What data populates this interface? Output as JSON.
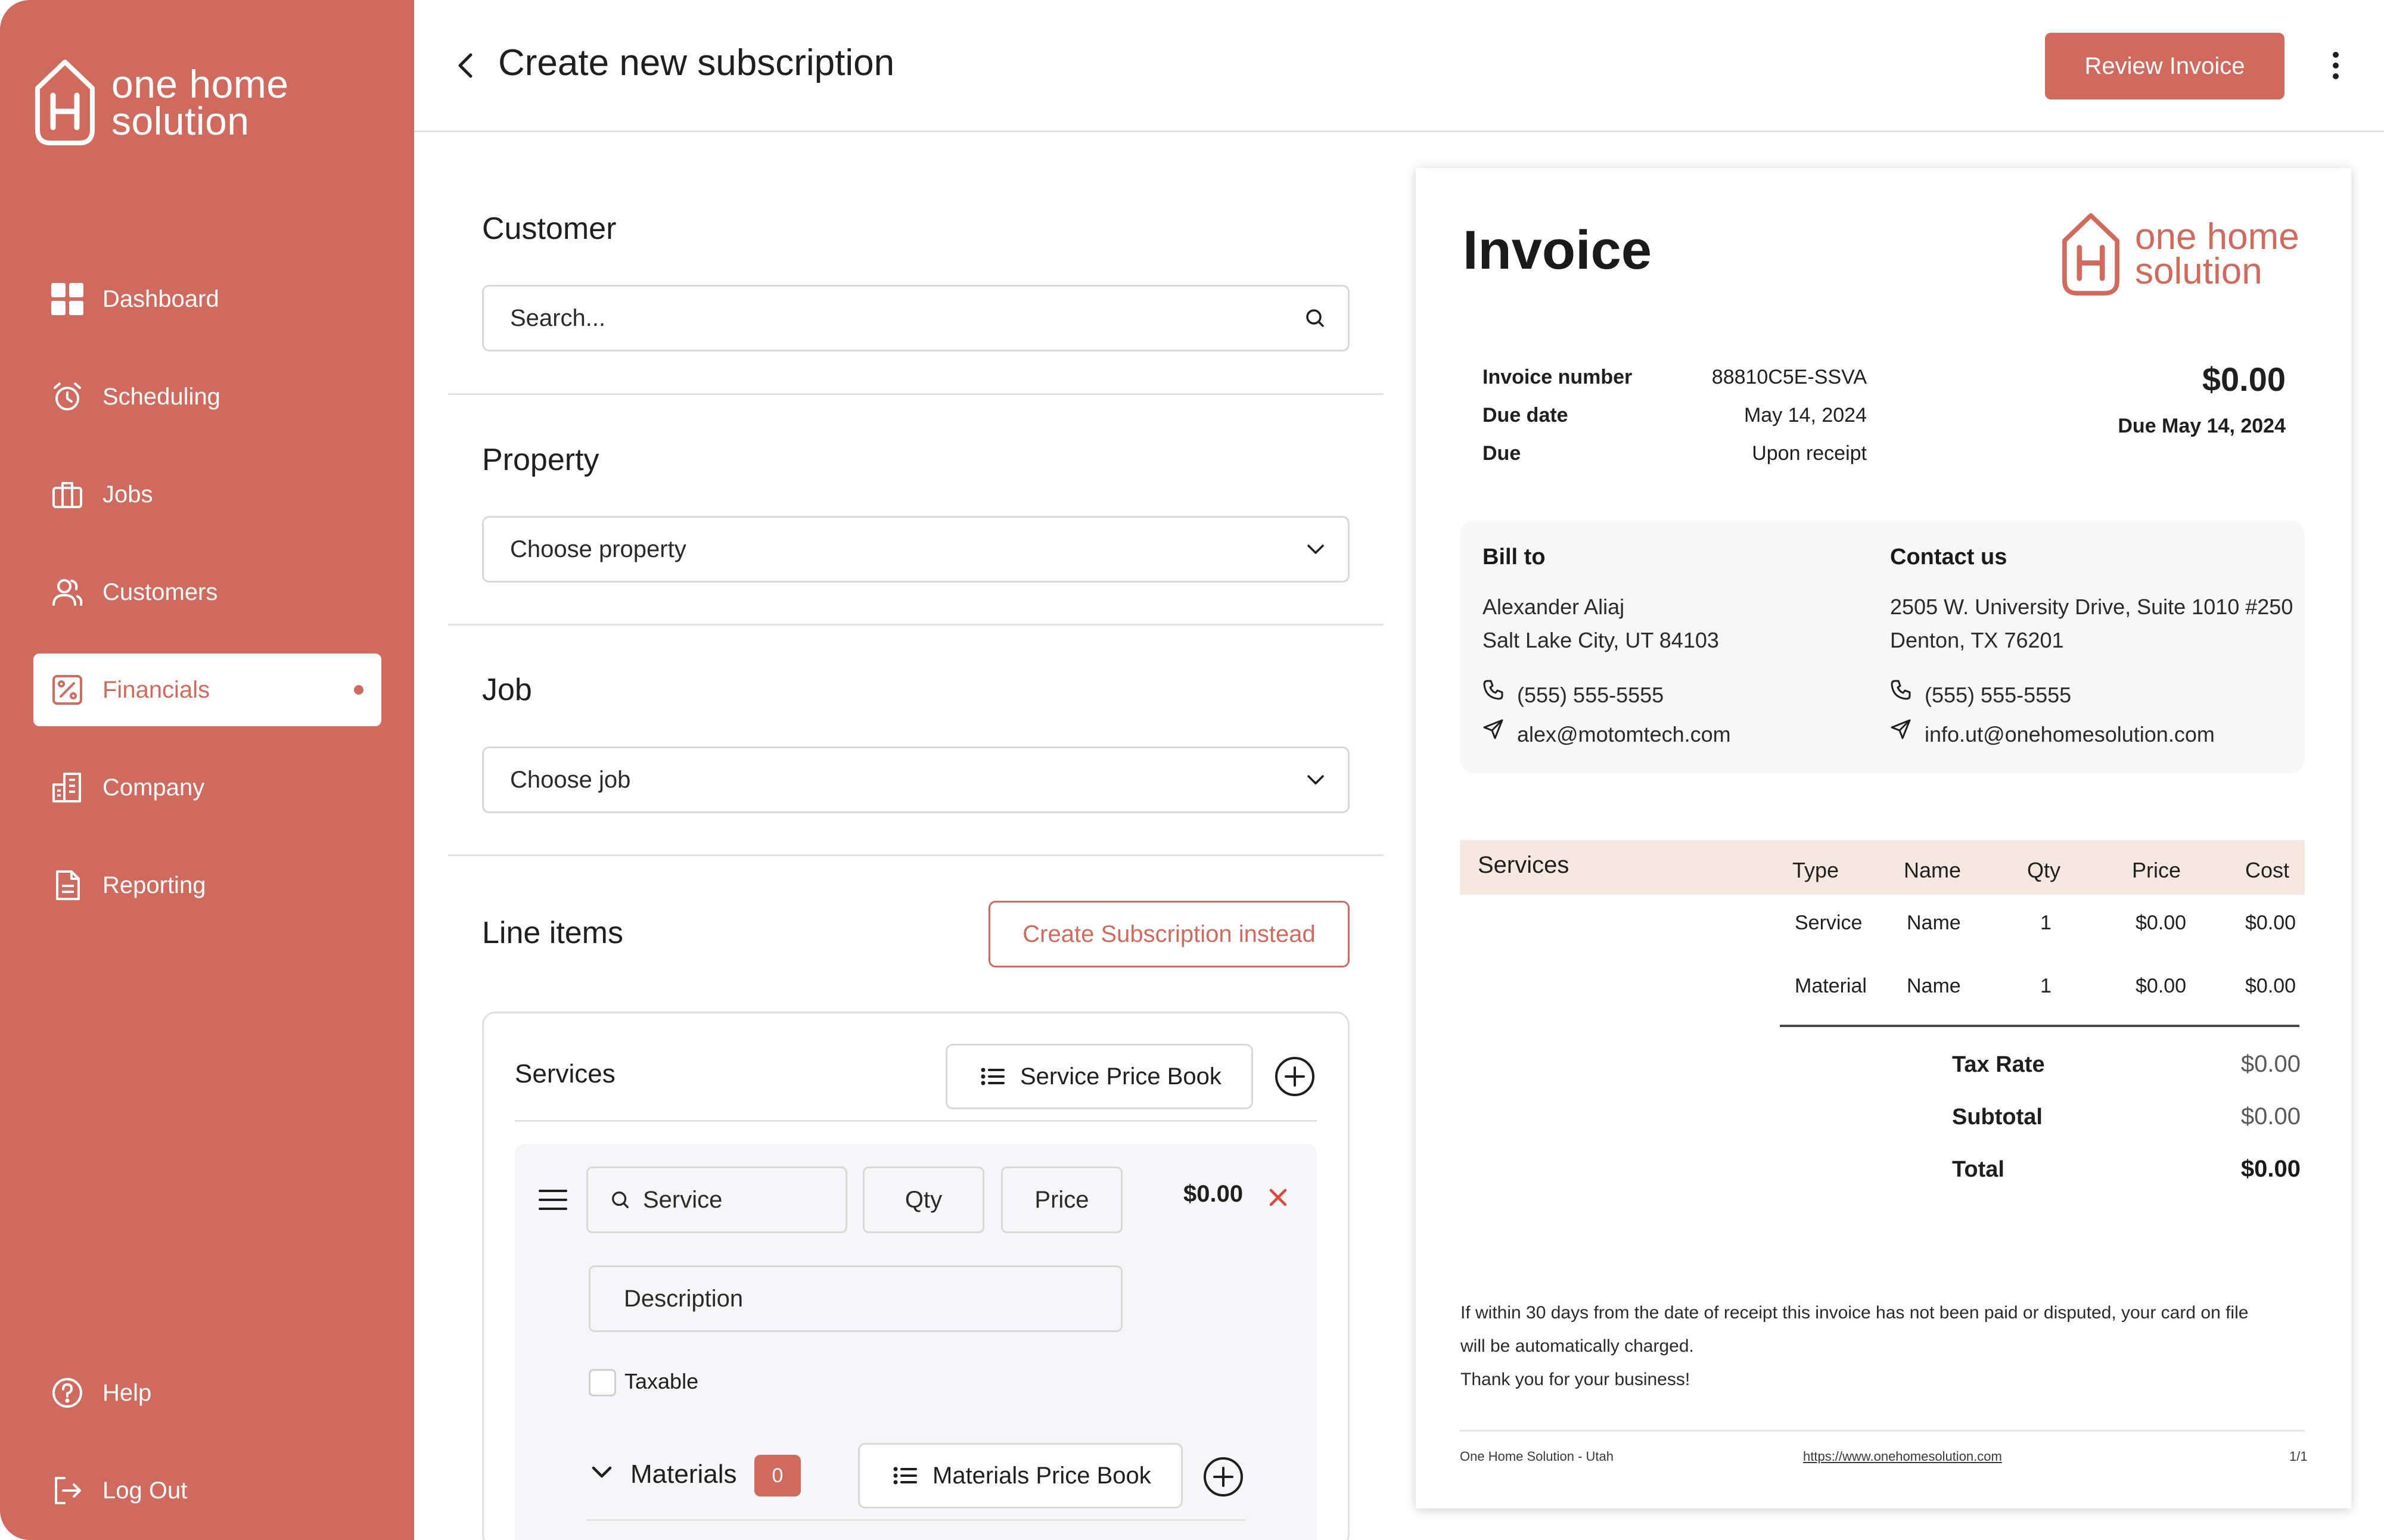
{
  "brand": {
    "line1": "one home",
    "line2": "solution",
    "accent_color": "#d16a5e",
    "logo_icon": "house-h-logo-icon"
  },
  "sidebar": {
    "items": [
      {
        "label": "Dashboard",
        "icon": "grid-icon"
      },
      {
        "label": "Scheduling",
        "icon": "alarm-clock-icon"
      },
      {
        "label": "Jobs",
        "icon": "briefcase-icon"
      },
      {
        "label": "Customers",
        "icon": "users-icon"
      },
      {
        "label": "Financials",
        "icon": "percent-tag-icon",
        "active": true
      },
      {
        "label": "Company",
        "icon": "building-icon"
      },
      {
        "label": "Reporting",
        "icon": "document-icon"
      }
    ],
    "bottom": [
      {
        "label": "Help",
        "icon": "question-circle-icon"
      },
      {
        "label": "Log Out",
        "icon": "logout-icon"
      }
    ]
  },
  "header": {
    "title": "Create new subscription",
    "review_button": "Review Invoice"
  },
  "form": {
    "customer": {
      "title": "Customer",
      "placeholder": "Search..."
    },
    "property": {
      "title": "Property",
      "value": "Choose property"
    },
    "job": {
      "title": "Job",
      "value": "Choose job"
    },
    "line_items": {
      "title": "Line items",
      "create_subscription_button": "Create Subscription instead",
      "services": {
        "title": "Services",
        "price_book_button": "Service Price Book",
        "row": {
          "service_placeholder": "Service",
          "qty_placeholder": "Qty",
          "price_placeholder": "Price",
          "amount": "$0.00",
          "description_placeholder": "Description",
          "taxable_label": "Taxable"
        }
      },
      "materials": {
        "title": "Materials",
        "count": "0",
        "price_book_button": "Materials Price Book"
      }
    }
  },
  "invoice": {
    "title": "Invoice",
    "meta": [
      {
        "label": "Invoice number",
        "value": "88810C5E-SSVA"
      },
      {
        "label": "Due date",
        "value": "May 14, 2024"
      },
      {
        "label": "Due",
        "value": "Upon receipt"
      }
    ],
    "amount_due": "$0.00",
    "due_line": "Due May 14, 2024",
    "bill_to": {
      "title": "Bill to",
      "name": "Alexander Aliaj",
      "city": "Salt Lake City, UT 84103",
      "phone": "(555) 555-5555",
      "email": "alex@motomtech.com"
    },
    "contact_us": {
      "title": "Contact us",
      "address1": "2505 W. University Drive, Suite 1010 #250",
      "address2": "Denton, TX 76201",
      "phone": "(555) 555-5555",
      "email": "info.ut@onehomesolution.com"
    },
    "table": {
      "section": "Services",
      "columns": [
        "Type",
        "Name",
        "Qty",
        "Price",
        "Cost"
      ],
      "rows": [
        [
          "Service",
          "Name",
          "1",
          "$0.00",
          "$0.00"
        ],
        [
          "Material",
          "Name",
          "1",
          "$0.00",
          "$0.00"
        ]
      ]
    },
    "summary": [
      {
        "label": "Tax Rate",
        "value": "$0.00"
      },
      {
        "label": "Subtotal",
        "value": "$0.00"
      },
      {
        "label": "Total",
        "value": "$0.00"
      }
    ],
    "note_line1": "If within 30 days from the date of receipt this invoice has not been paid or disputed, your card on file",
    "note_line2": "will be automatically charged.",
    "note_line3": "Thank you for your business!",
    "footer": {
      "company": "One Home Solution - Utah",
      "link": "https://www.onehomesolution.com",
      "page": "1/1"
    }
  }
}
